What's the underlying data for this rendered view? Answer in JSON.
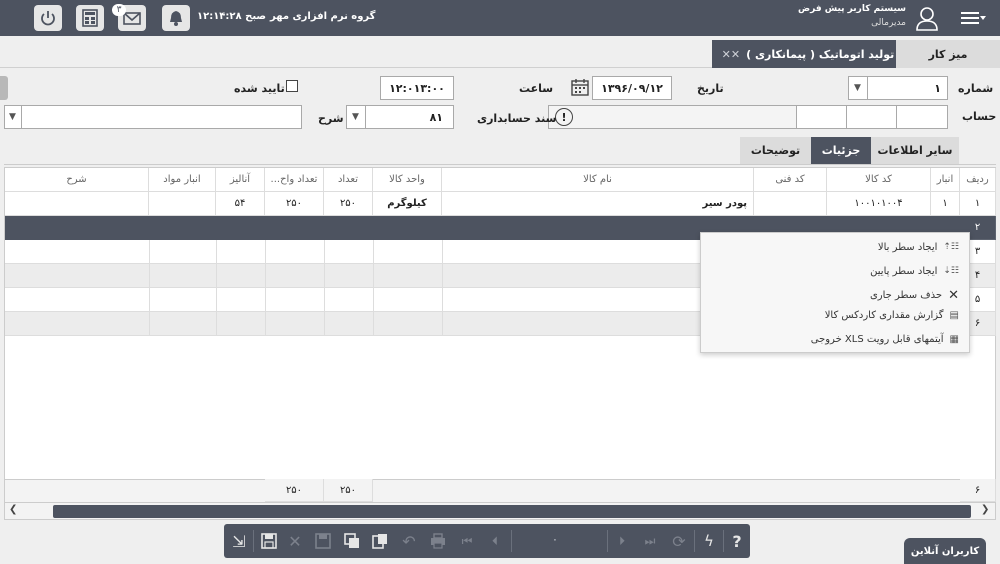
{
  "topbar": {
    "company": "سیستم کاربر پیش فرض",
    "role": "مدیرمالی",
    "group": "گروه نرم افزاری مهر",
    "time": "۱۲:۱۴:۲۸ صبح",
    "mail_count": "۳"
  },
  "tabs": {
    "desk": "میز کار",
    "active": "تولید اتوماتیک ( پیمانکاری )"
  },
  "form": {
    "number_label": "شماره",
    "number_value": "۱",
    "date_label": "تاریخ",
    "date_value": "۱۳۹۶/۰۹/۱۲",
    "time_label": "ساعت",
    "time_value": "۱۲:۰۱۳:۰۰",
    "approved_label": "تایید شده",
    "account_label": "حساب",
    "voucher_label": "سند حسابداری",
    "desc_label": "شرح",
    "desc_value": "۸۱"
  },
  "subtabs": {
    "other": "سایر اطلاعات",
    "details": "جزئیات",
    "notes": "توضیحات"
  },
  "grid": {
    "headers": [
      "ردیف",
      "انبار",
      "کد کالا",
      "کد فنی",
      "نام کالا",
      "واحد کالا",
      "تعداد",
      "...تعداد واح",
      "آنالیز",
      "انبار مواد",
      "شرح"
    ],
    "rows": [
      {
        "row": "۱",
        "warehouse": "۱",
        "code": "۱۰۰۱۰۱۰۰۴",
        "tech": "",
        "name": "پودر سیر",
        "unit": "کیلوگرم",
        "qty": "۲۵۰",
        "qty2": "۲۵۰",
        "analysis": "۵۴",
        "mat": "",
        "desc": ""
      },
      {
        "row": "۲"
      },
      {
        "row": "۳"
      },
      {
        "row": "۴"
      },
      {
        "row": "۵"
      },
      {
        "row": "۶"
      }
    ],
    "footer": {
      "count": "۶",
      "qty": "۲۵۰",
      "qty2": "۲۵۰"
    }
  },
  "context_menu": [
    "ایجاد سطر بالا",
    "ایجاد سطر پایین",
    "حذف سطر جاری",
    "گزارش مقداری کاردکس کالا",
    "خروجی XLS آیتمهای قابل رویت"
  ],
  "bottombar": {
    "page": "۰"
  },
  "online_users": "کاربران آنلاین",
  "colors": {
    "dark": "#4d5360",
    "light": "#efefef",
    "selected_row": "#4d5360"
  }
}
